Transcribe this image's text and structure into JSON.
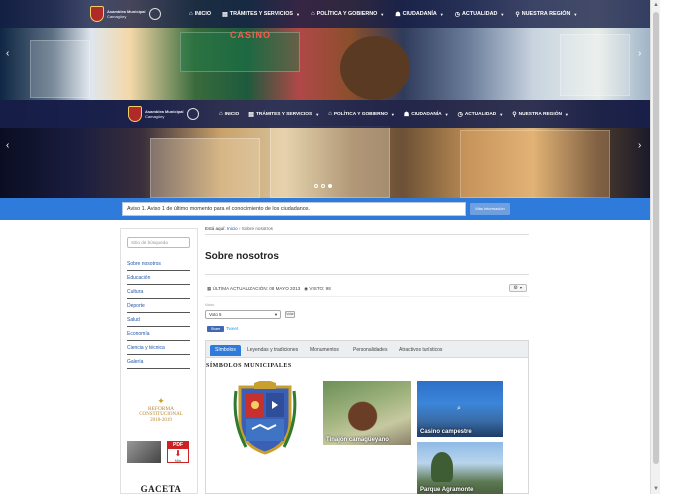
{
  "header": {
    "logo_line1": "Asamblea Municipal",
    "logo_line2": "Camagüey",
    "menu": [
      {
        "icon": "home-icon",
        "glyph": "⌂",
        "label": "Inicio"
      },
      {
        "icon": "document-icon",
        "glyph": "▤",
        "label": "Trámites y servicios"
      },
      {
        "icon": "bank-icon",
        "glyph": "⌂",
        "label": "Política y gobierno"
      },
      {
        "icon": "users-icon",
        "glyph": "☗",
        "label": "Ciudadanía"
      },
      {
        "icon": "clock-icon",
        "glyph": "◷",
        "label": "Actualidad"
      },
      {
        "icon": "map-pin-icon",
        "glyph": "⚲",
        "label": "Nuestra región"
      }
    ],
    "hero_sign": "CASINO"
  },
  "alert": {
    "text": "Aviso 1. Aviso 1 de último momento para el conocimiento de los ciudadanos.",
    "button_label": "Más información"
  },
  "sidebar": {
    "search_placeholder": "Sitio de búsqueda",
    "items": [
      {
        "label": "Sobre nosotros"
      },
      {
        "label": "Educación"
      },
      {
        "label": "Cultura"
      },
      {
        "label": "Deporte"
      },
      {
        "label": "Salud"
      },
      {
        "label": "Economía"
      },
      {
        "label": "Ciencia y técnica"
      },
      {
        "label": "Galería"
      }
    ],
    "reforma_line1": "Reforma",
    "reforma_line2": "Constitucional",
    "reforma_years": "2018-2019",
    "pdf_label": "PDF",
    "pdf_size": "Mbs",
    "gaceta": "GACETA"
  },
  "breadcrumb": {
    "label": "Está aquí:",
    "home": "Inicio",
    "sep": "›",
    "current": "Sobre nosotros"
  },
  "article": {
    "title": "Sobre nosotros",
    "updated": "Última actualización: 08 mayo 2013",
    "views": "Visto: 98",
    "vote_label": "Votos",
    "vote_value": "Voto 5",
    "vote_button": "Votar",
    "share_fb": "Share",
    "share_tw": "Tweet",
    "tabs": [
      {
        "label": "Símbolos"
      },
      {
        "label": "Leyendas y tradiciones"
      },
      {
        "label": "Monumentos"
      },
      {
        "label": "Personalidades"
      },
      {
        "label": "Atractivos turísticos"
      }
    ],
    "section_heading": "SÍMBOLOS MUNICIPALES",
    "photos": [
      {
        "caption": "Tinajón camagüeyano"
      },
      {
        "caption": "Casino campestre"
      },
      {
        "caption": "Parque Agramonte"
      }
    ]
  }
}
